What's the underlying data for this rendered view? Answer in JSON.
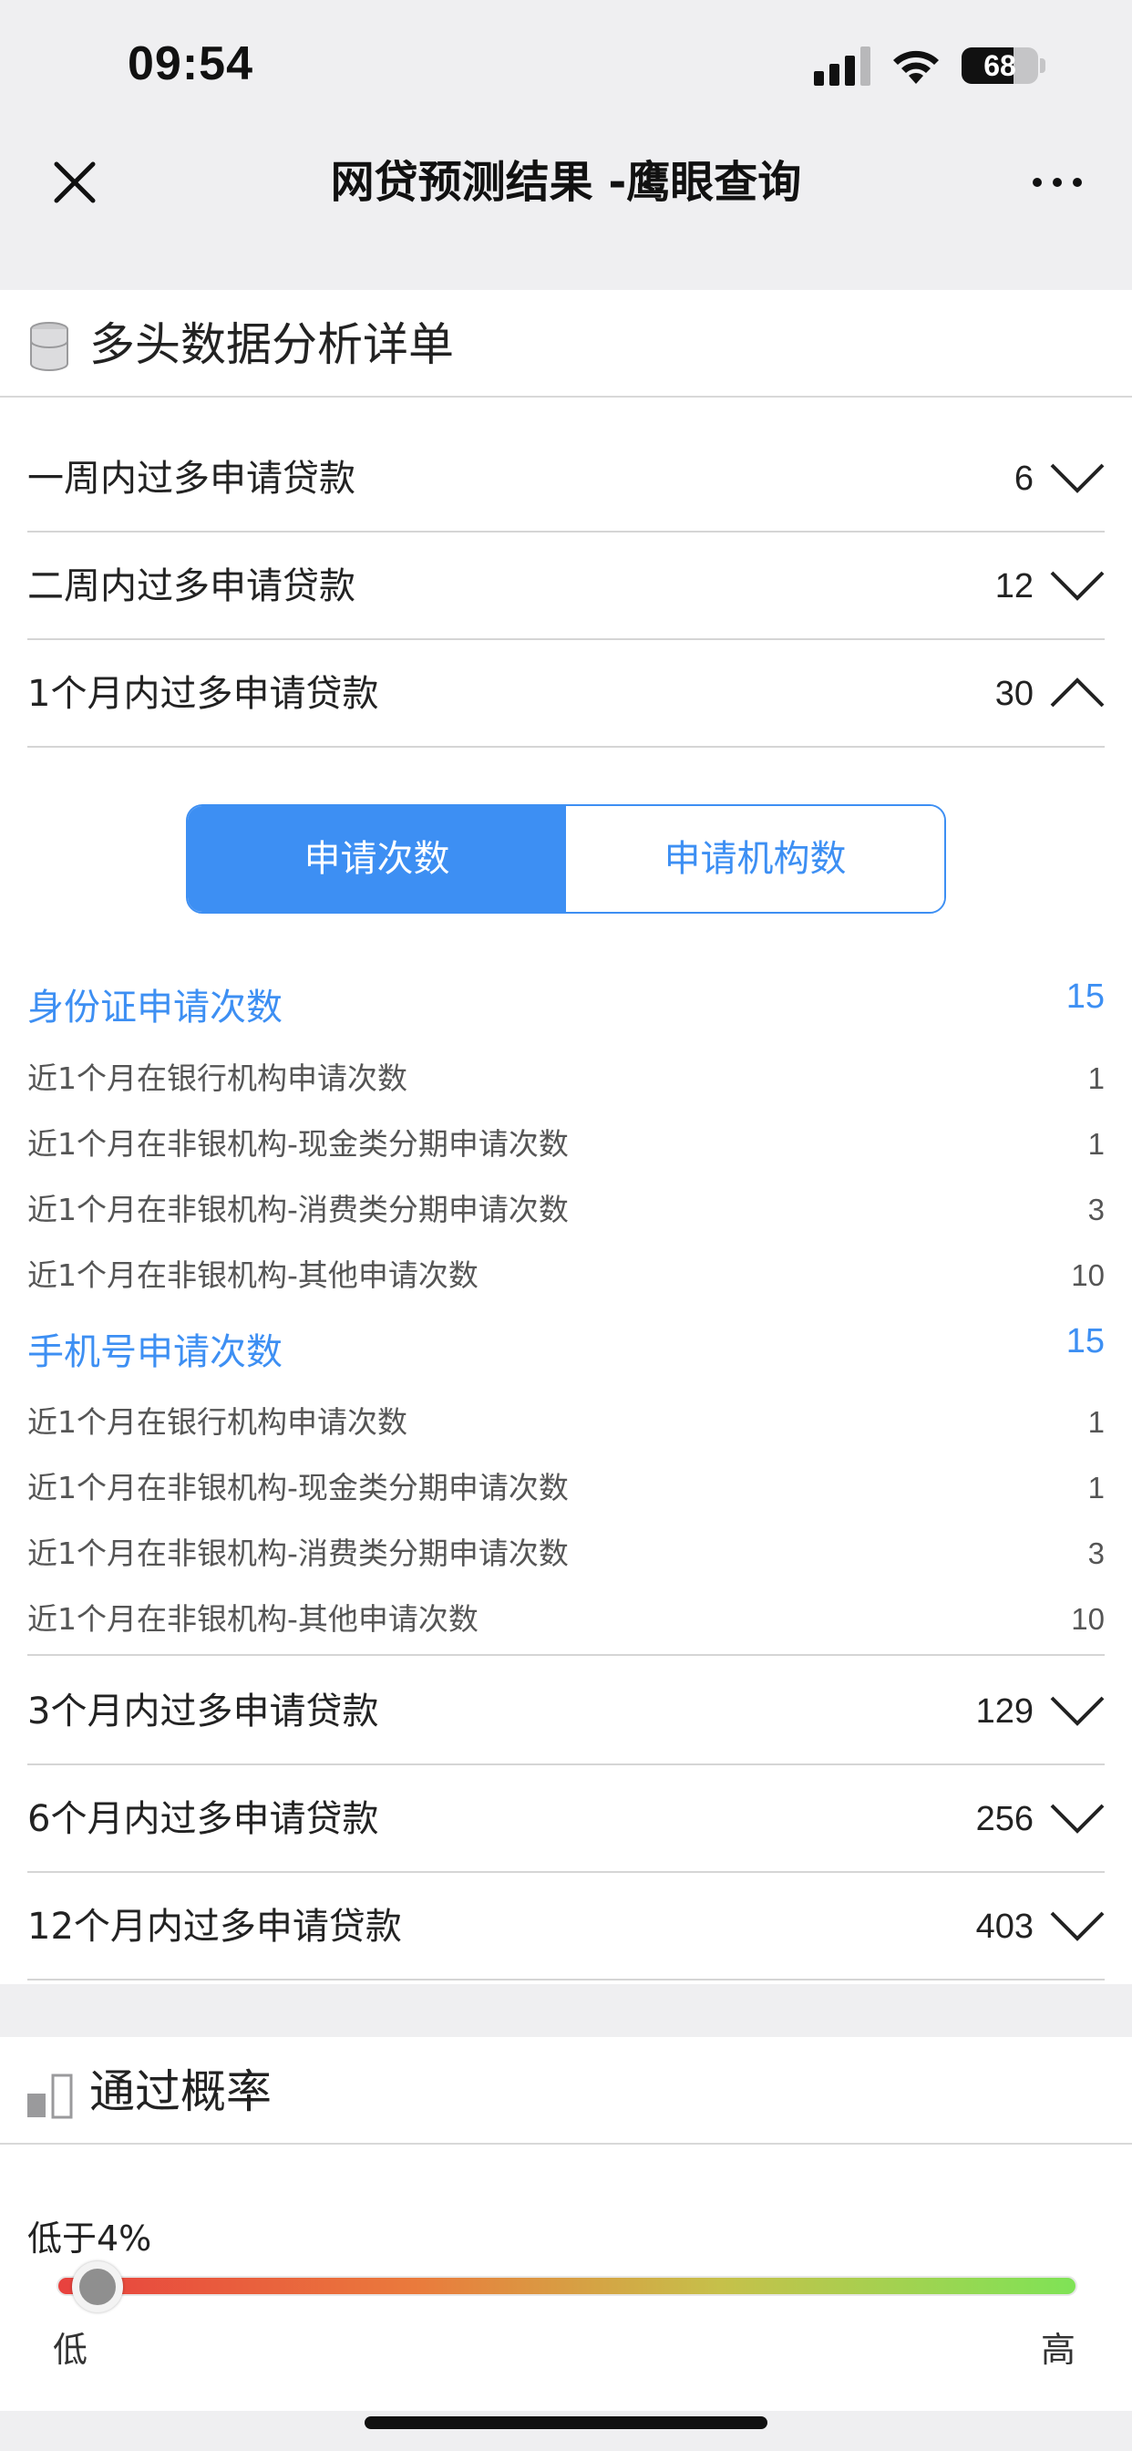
{
  "status": {
    "time": "09:54",
    "battery": "68",
    "battery_level": 0.68,
    "icons": [
      "signal-icon",
      "wifi-icon",
      "battery-icon"
    ]
  },
  "nav": {
    "title": "网贷预测结果 -鹰眼查询",
    "icons": [
      "close-icon",
      "more-icon"
    ]
  },
  "multi": {
    "title": "多头数据分析详单",
    "icon": "database-icon",
    "rows_top": [
      {
        "label": "一周内过多申请贷款",
        "count": "6",
        "expanded": false
      },
      {
        "label": "二周内过多申请贷款",
        "count": "12",
        "expanded": false
      },
      {
        "label": "1个月内过多申请贷款",
        "count": "30",
        "expanded": true
      }
    ],
    "segment": {
      "active": "申请次数",
      "inactive": "申请机构数"
    },
    "groups": [
      {
        "title": "身份证申请次数",
        "total": "15",
        "items": [
          {
            "label": "近1个月在银行机构申请次数",
            "value": "1"
          },
          {
            "label": "近1个月在非银机构-现金类分期申请次数",
            "value": "1"
          },
          {
            "label": "近1个月在非银机构-消费类分期申请次数",
            "value": "3"
          },
          {
            "label": "近1个月在非银机构-其他申请次数",
            "value": "10"
          }
        ]
      },
      {
        "title": "手机号申请次数",
        "total": "15",
        "items": [
          {
            "label": "近1个月在银行机构申请次数",
            "value": "1"
          },
          {
            "label": "近1个月在非银机构-现金类分期申请次数",
            "value": "1"
          },
          {
            "label": "近1个月在非银机构-消费类分期申请次数",
            "value": "3"
          },
          {
            "label": "近1个月在非银机构-其他申请次数",
            "value": "10"
          }
        ]
      }
    ],
    "rows_bottom": [
      {
        "label": "3个月内过多申请贷款",
        "count": "129",
        "expanded": false
      },
      {
        "label": "6个月内过多申请贷款",
        "count": "256",
        "expanded": false
      },
      {
        "label": "12个月内过多申请贷款",
        "count": "403",
        "expanded": false
      }
    ]
  },
  "pass_rate": {
    "title": "通过概率",
    "icon": "bar-chart-icon",
    "value_label": "低于4%",
    "level": 0.04,
    "low_label": "低",
    "high_label": "高",
    "colors": {
      "start": "#e8413e",
      "end": "#7fe356"
    }
  }
}
